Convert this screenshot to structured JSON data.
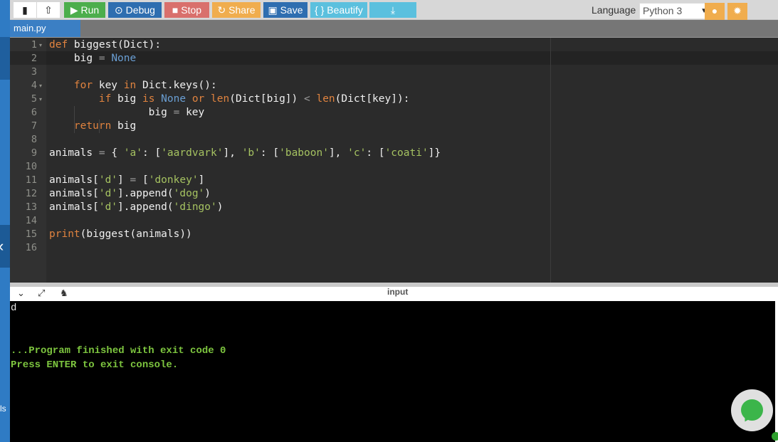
{
  "toolbar": {
    "run": "Run",
    "debug": "Debug",
    "stop": "Stop",
    "share": "Share",
    "save": "Save",
    "beautify": "{ } Beautify",
    "language_label": "Language",
    "language_value": "Python 3"
  },
  "tab": {
    "label": "main.py"
  },
  "code": [
    [
      {
        "t": "def ",
        "c": "k"
      },
      {
        "t": "biggest(Dict):",
        "c": ""
      }
    ],
    [
      {
        "t": "    big ",
        "c": ""
      },
      {
        "t": "= ",
        "c": "o"
      },
      {
        "t": "None",
        "c": "n"
      }
    ],
    [],
    [
      {
        "t": "    ",
        "c": ""
      },
      {
        "t": "for ",
        "c": "k"
      },
      {
        "t": "key ",
        "c": ""
      },
      {
        "t": "in ",
        "c": "k"
      },
      {
        "t": "Dict.keys():",
        "c": ""
      }
    ],
    [
      {
        "t": "        ",
        "c": ""
      },
      {
        "t": "if ",
        "c": "k"
      },
      {
        "t": "big ",
        "c": ""
      },
      {
        "t": "is ",
        "c": "k"
      },
      {
        "t": "None ",
        "c": "n"
      },
      {
        "t": "or ",
        "c": "k"
      },
      {
        "t": "len",
        "c": "b"
      },
      {
        "t": "(Dict[big]) ",
        "c": ""
      },
      {
        "t": "< ",
        "c": "o"
      },
      {
        "t": "len",
        "c": "b"
      },
      {
        "t": "(Dict[key]):",
        "c": ""
      }
    ],
    [
      {
        "t": "                big ",
        "c": ""
      },
      {
        "t": "= ",
        "c": "o"
      },
      {
        "t": "key",
        "c": ""
      }
    ],
    [
      {
        "t": "    ",
        "c": ""
      },
      {
        "t": "return ",
        "c": "k"
      },
      {
        "t": "big",
        "c": ""
      }
    ],
    [],
    [
      {
        "t": "animals ",
        "c": ""
      },
      {
        "t": "= ",
        "c": "o"
      },
      {
        "t": "{ ",
        "c": ""
      },
      {
        "t": "'a'",
        "c": "s"
      },
      {
        "t": ": [",
        "c": ""
      },
      {
        "t": "'aardvark'",
        "c": "s"
      },
      {
        "t": "], ",
        "c": ""
      },
      {
        "t": "'b'",
        "c": "s"
      },
      {
        "t": ": [",
        "c": ""
      },
      {
        "t": "'baboon'",
        "c": "s"
      },
      {
        "t": "], ",
        "c": ""
      },
      {
        "t": "'c'",
        "c": "s"
      },
      {
        "t": ": [",
        "c": ""
      },
      {
        "t": "'coati'",
        "c": "s"
      },
      {
        "t": "]}",
        "c": ""
      }
    ],
    [],
    [
      {
        "t": "animals[",
        "c": ""
      },
      {
        "t": "'d'",
        "c": "s"
      },
      {
        "t": "] ",
        "c": ""
      },
      {
        "t": "= ",
        "c": "o"
      },
      {
        "t": "[",
        "c": ""
      },
      {
        "t": "'donkey'",
        "c": "s"
      },
      {
        "t": "]",
        "c": ""
      }
    ],
    [
      {
        "t": "animals[",
        "c": ""
      },
      {
        "t": "'d'",
        "c": "s"
      },
      {
        "t": "].append(",
        "c": ""
      },
      {
        "t": "'dog'",
        "c": "s"
      },
      {
        "t": ")",
        "c": ""
      }
    ],
    [
      {
        "t": "animals[",
        "c": ""
      },
      {
        "t": "'d'",
        "c": "s"
      },
      {
        "t": "].append(",
        "c": ""
      },
      {
        "t": "'dingo'",
        "c": "s"
      },
      {
        "t": ")",
        "c": ""
      }
    ],
    [],
    [
      {
        "t": "print",
        "c": "b"
      },
      {
        "t": "(biggest(animals))",
        "c": ""
      }
    ],
    []
  ],
  "io": {
    "label": "input"
  },
  "console": {
    "lines": [
      "d",
      "",
      "",
      "...Program finished with exit code 0",
      "Press ENTER to exit console."
    ],
    "colors": [
      "#e8e8e8",
      "",
      "",
      "#7dc53f",
      "#7dc53f"
    ]
  },
  "sidebar": {
    "text": "ls"
  }
}
